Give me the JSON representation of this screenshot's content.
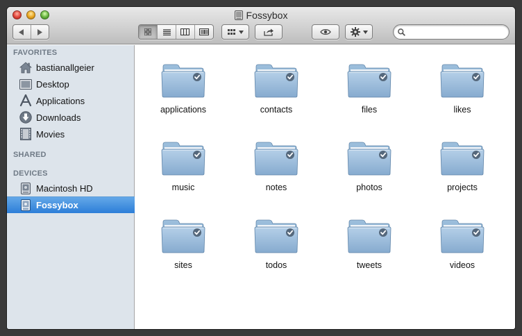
{
  "window": {
    "title": "Fossybox"
  },
  "sidebar": {
    "favorites_title": "FAVORITES",
    "favorites": [
      {
        "label": "bastianallgeier",
        "icon": "home-icon"
      },
      {
        "label": "Desktop",
        "icon": "desktop-icon"
      },
      {
        "label": "Applications",
        "icon": "applications-icon"
      },
      {
        "label": "Downloads",
        "icon": "downloads-icon"
      },
      {
        "label": "Movies",
        "icon": "movies-icon"
      }
    ],
    "shared_title": "SHARED",
    "devices_title": "DEVICES",
    "devices": [
      {
        "label": "Macintosh HD",
        "icon": "hard-drive-icon",
        "selected": false
      },
      {
        "label": "Fossybox",
        "icon": "external-drive-icon",
        "selected": true
      }
    ]
  },
  "search": {
    "placeholder": ""
  },
  "folders": [
    {
      "label": "applications"
    },
    {
      "label": "contacts"
    },
    {
      "label": "files"
    },
    {
      "label": "likes"
    },
    {
      "label": "music"
    },
    {
      "label": "notes"
    },
    {
      "label": "photos"
    },
    {
      "label": "projects"
    },
    {
      "label": "sites"
    },
    {
      "label": "todos"
    },
    {
      "label": "tweets"
    },
    {
      "label": "videos"
    }
  ],
  "colors": {
    "selection": "#3a8ae0",
    "sidebar_bg": "#dde4eb",
    "folder": "#8fb3d3"
  }
}
